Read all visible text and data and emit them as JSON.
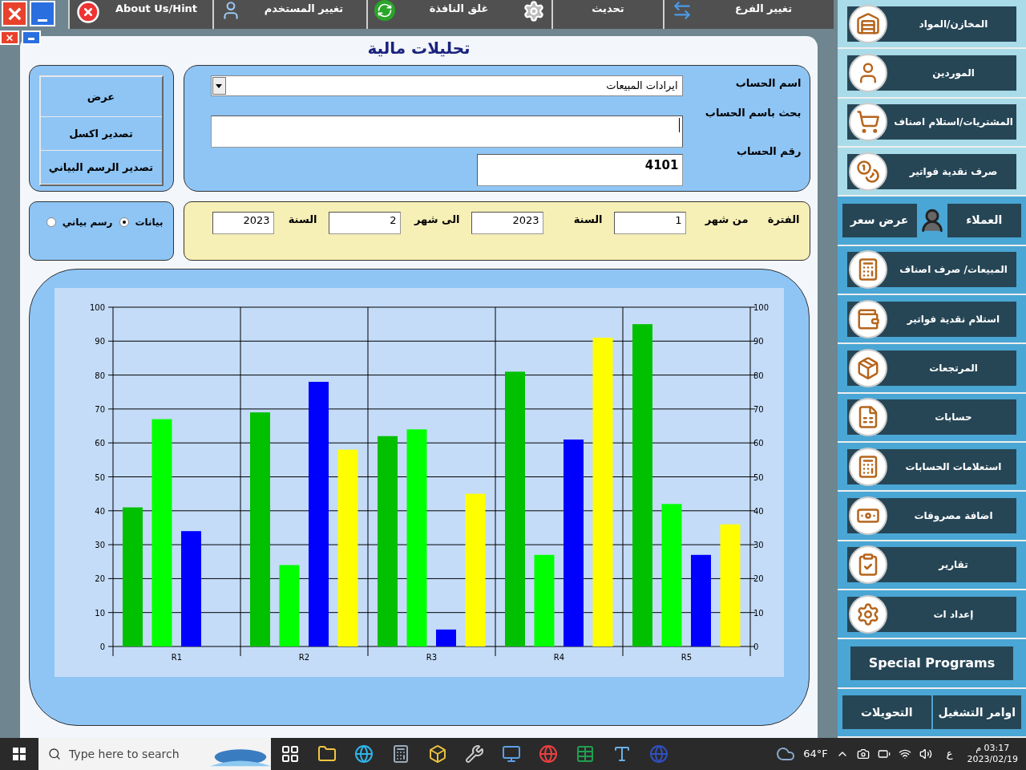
{
  "toolbar": [
    {
      "label": "تغيير الفرع"
    },
    {
      "label": "تحديث"
    },
    {
      "label": "غلق النافذة"
    },
    {
      "label": "تغيير المستخدم"
    },
    {
      "label": "About Us/Hint"
    }
  ],
  "title": "تحليلات مالية",
  "account": {
    "name_label": "اسم الحساب",
    "name_value": "ايرادات المبيعات",
    "search_label": "بحث باسم الحساب",
    "number_label": "رقم الحساب",
    "number_value": "4101"
  },
  "actions": [
    "عرض",
    "تصدير اكسل",
    "تصدير الرسم البياني"
  ],
  "view_mode": [
    {
      "label": "بيانات",
      "selected": true
    },
    {
      "label": "رسم بياني",
      "selected": false
    }
  ],
  "period": {
    "label": "الفترة",
    "from_month_label": "من شهر",
    "from_month": "1",
    "from_year_label": "السنة",
    "from_year": "2023",
    "to_month_label": "الى شهر",
    "to_month": "2",
    "to_year_label": "السنة",
    "to_year": "2023"
  },
  "chart_data": {
    "type": "bar",
    "categories": [
      "R1",
      "R2",
      "R3",
      "R4",
      "R5"
    ],
    "ylim": [
      0,
      100
    ],
    "yticks": [
      0,
      10,
      20,
      30,
      40,
      50,
      60,
      70,
      80,
      90,
      100
    ],
    "y2ticks": [
      0,
      10,
      20,
      30,
      40,
      50,
      60,
      70,
      80,
      90,
      100
    ],
    "y2lim": [
      0,
      100
    ],
    "grid": true,
    "series": [
      {
        "color": "#00c000",
        "values": [
          41,
          69,
          62,
          81,
          95
        ]
      },
      {
        "color": "#00ff00",
        "values": [
          67,
          24,
          64,
          27,
          42
        ]
      },
      {
        "color": "#0000ff",
        "values": [
          34,
          78,
          5,
          61,
          27
        ]
      },
      {
        "color": "#ffff00",
        "values": [
          null,
          58,
          45,
          91,
          36
        ]
      }
    ]
  },
  "sidebar": [
    {
      "kind": "single",
      "label": "المخازن/المواد"
    },
    {
      "kind": "single",
      "label": "الموردين"
    },
    {
      "kind": "single",
      "label": "المشتريات/استلام اصناف"
    },
    {
      "kind": "single",
      "label": "صرف نقدية فواتير"
    },
    {
      "kind": "split",
      "labels": [
        "العملاء",
        "عرض سعر"
      ]
    },
    {
      "kind": "single",
      "label": "المبيعات/ صرف اصناف"
    },
    {
      "kind": "single",
      "label": "استلام نقدية فواتير"
    },
    {
      "kind": "single",
      "label": "المرتجعات"
    },
    {
      "kind": "single",
      "label": "حسابات"
    },
    {
      "kind": "single",
      "label": "استعلامات الحسابات"
    },
    {
      "kind": "single",
      "label": "اضافة مصروفات"
    },
    {
      "kind": "single",
      "label": "تقارير"
    },
    {
      "kind": "single",
      "label": "إعداد ات"
    },
    {
      "kind": "plain",
      "label": "Special Programs"
    },
    {
      "kind": "split",
      "labels": [
        "اوامر التشغيل",
        "التحويلات"
      ]
    }
  ],
  "taskbar": {
    "search_placeholder": "Type here to search",
    "weather": "64°F",
    "language": "ع",
    "time": "03:17 م",
    "date": "2023/02/19"
  }
}
